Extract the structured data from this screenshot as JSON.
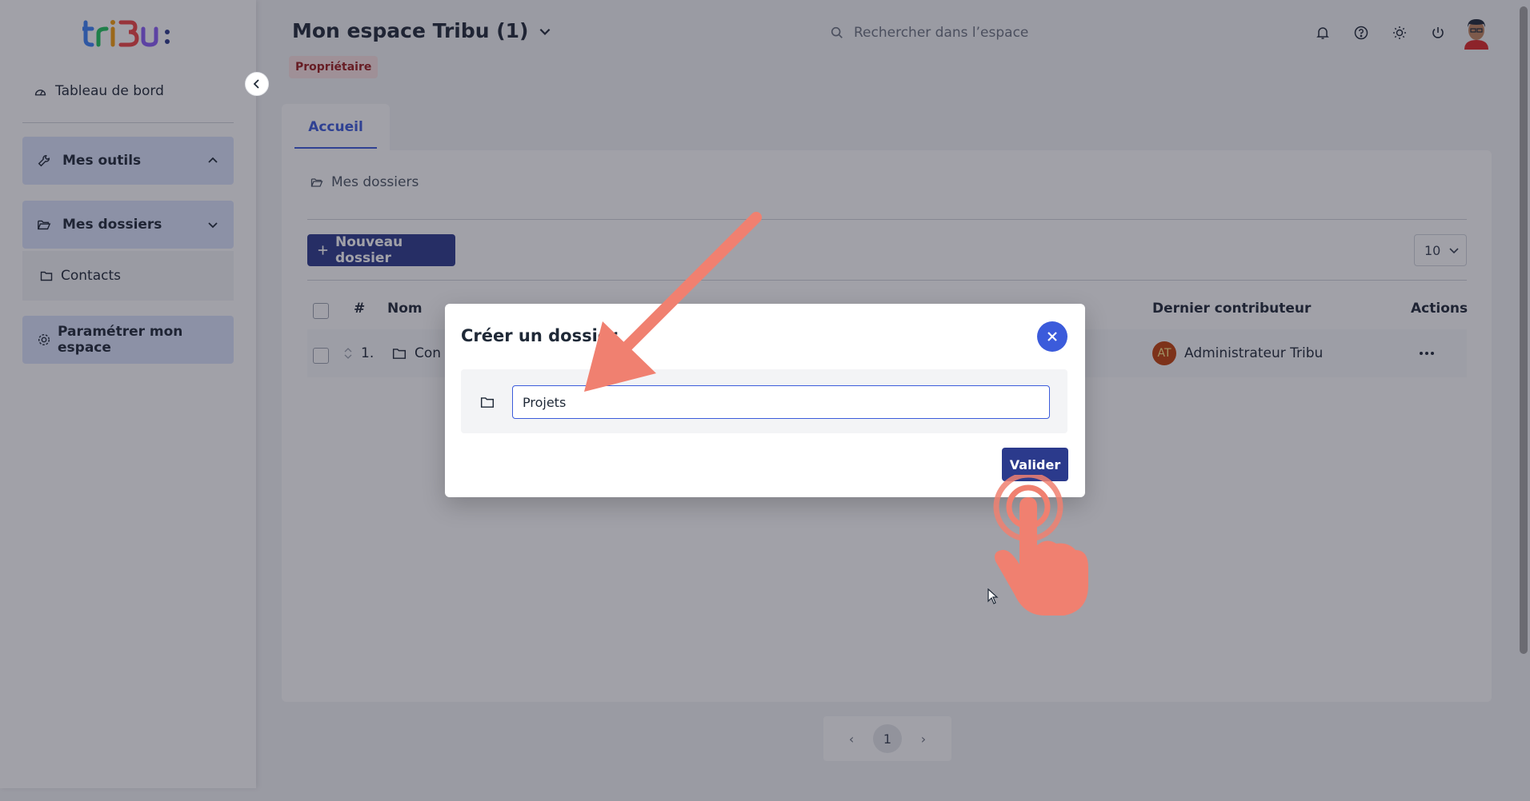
{
  "sidebar": {
    "dashboard_label": "Tableau de bord",
    "tools_label": "Mes outils",
    "folders_label": "Mes dossiers",
    "sub_folders": [
      "Contacts"
    ],
    "settings_label": "Paramétrer mon espace"
  },
  "header": {
    "space_title": "Mon espace Tribu (1)",
    "role_badge": "Propriétaire",
    "search_placeholder": "Rechercher dans l’espace"
  },
  "tabs": [
    {
      "label": "Accueil",
      "active": true
    }
  ],
  "main": {
    "breadcrumb": "Mes dossiers",
    "new_folder_label": "Nouveau dossier",
    "per_page": "10",
    "table": {
      "headers": {
        "index": "#",
        "name": "Nom",
        "last_contributor": "Dernier contributeur",
        "actions": "Actions"
      },
      "rows": [
        {
          "index": "1.",
          "name": "Con",
          "contributor_initials": "AT",
          "contributor": "Administrateur Tribu"
        }
      ]
    },
    "pagination": {
      "current": "1"
    }
  },
  "modal": {
    "title": "Créer un dossier",
    "input_value": "Projets",
    "submit_label": "Valider"
  },
  "colors": {
    "primary": "#2b3a8c",
    "accent": "#3b5bdb",
    "badge_bg": "#fbe2e2",
    "badge_text": "#9b1c1c",
    "annotation": "#f08070"
  }
}
